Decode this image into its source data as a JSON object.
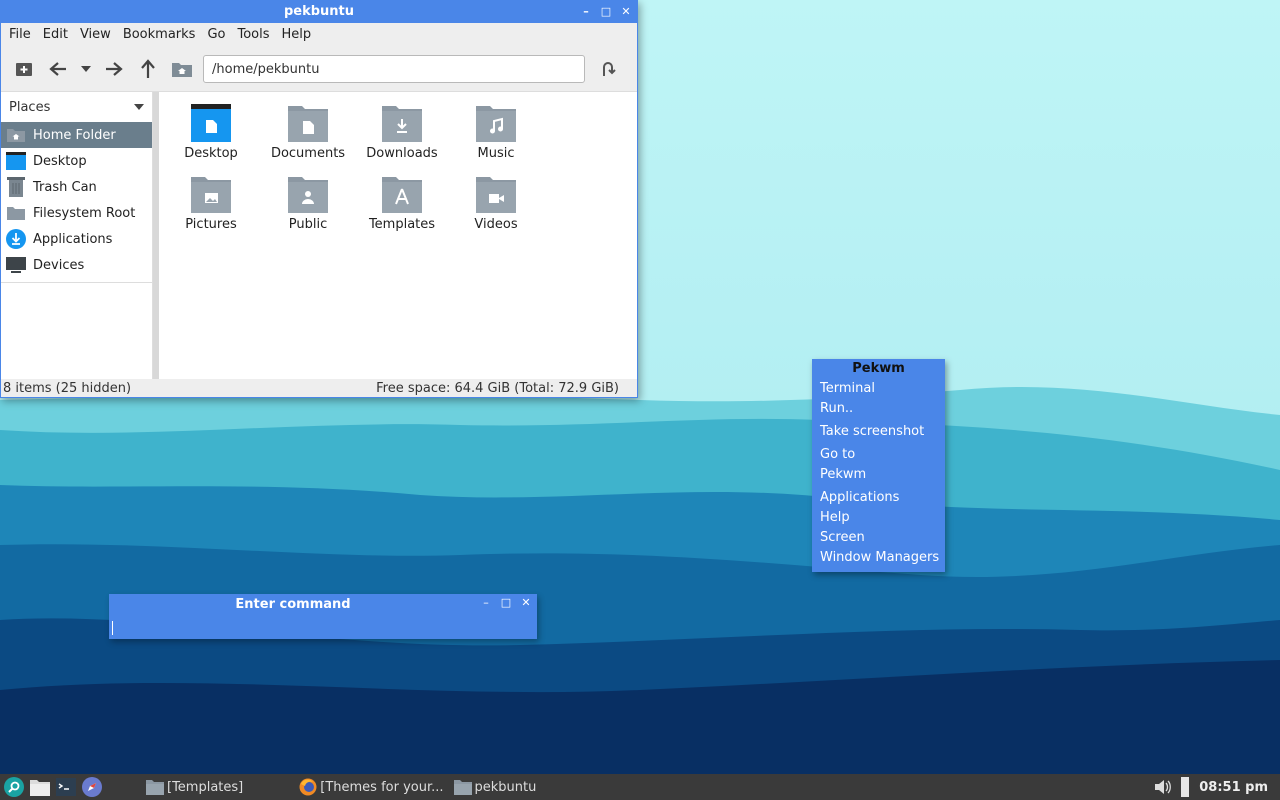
{
  "colors": {
    "accent": "#4a86e8",
    "taskbar": "#3a3a3a",
    "folder": "#8c98a3",
    "desktop_folder": "#1e90ff"
  },
  "file_manager": {
    "title": "pekbuntu",
    "menu": [
      "File",
      "Edit",
      "View",
      "Bookmarks",
      "Go",
      "Tools",
      "Help"
    ],
    "address": "/home/pekbuntu",
    "places_label": "Places",
    "places": [
      {
        "label": "Home Folder",
        "icon": "home-folder-icon"
      },
      {
        "label": "Desktop",
        "icon": "desktop-icon"
      },
      {
        "label": "Trash Can",
        "icon": "trash-icon"
      },
      {
        "label": "Filesystem Root",
        "icon": "drive-icon"
      },
      {
        "label": "Applications",
        "icon": "applications-icon"
      },
      {
        "label": "Devices",
        "icon": "devices-icon"
      }
    ],
    "items": [
      {
        "label": "Desktop",
        "icon": "desktop-folder-icon"
      },
      {
        "label": "Documents",
        "icon": "documents-folder-icon"
      },
      {
        "label": "Downloads",
        "icon": "downloads-folder-icon"
      },
      {
        "label": "Music",
        "icon": "music-folder-icon"
      },
      {
        "label": "Pictures",
        "icon": "pictures-folder-icon"
      },
      {
        "label": "Public",
        "icon": "public-folder-icon"
      },
      {
        "label": "Templates",
        "icon": "templates-folder-icon"
      },
      {
        "label": "Videos",
        "icon": "videos-folder-icon"
      }
    ],
    "status_left": "8 items (25 hidden)",
    "status_right": "Free space: 64.4 GiB (Total: 72.9 GiB)"
  },
  "pekwm_menu": {
    "title": "Pekwm",
    "items": [
      "Terminal",
      "Run..",
      "Take screenshot",
      "Go to",
      "Pekwm",
      "Applications",
      "Help",
      "Screen",
      "Window Managers"
    ]
  },
  "command_window": {
    "title": "Enter command",
    "value": ""
  },
  "taskbar": {
    "tasks": [
      "[Templates]",
      "[Themes for your...",
      "pekbuntu"
    ],
    "clock": "08:51 pm"
  }
}
